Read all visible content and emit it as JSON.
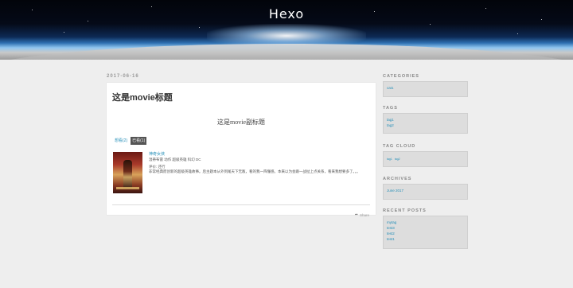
{
  "site": {
    "title": "Hexo"
  },
  "post": {
    "date": "2017-06-16",
    "title": "这是movie标题",
    "subtitle": "这是movie副标题",
    "tabs": [
      {
        "label": "想看(2)",
        "active": false
      },
      {
        "label": "已看(1)",
        "active": true
      }
    ],
    "movie": {
      "name": "神奇女侠",
      "meta": "温蒂布雷 动作 超级英雄 科幻 DC",
      "rating": "评价: 还行",
      "summary": "非常经典而创新的超级英雄故事。后主题本从外到尾天下无敌，看的我一阵懂感。本来以为会跟一战扯上点关系，看来我想要多了。。。"
    },
    "share_label": "Share"
  },
  "sidebar": {
    "categories": {
      "title": "CATEGORIES",
      "items": [
        "cat1"
      ]
    },
    "tags": {
      "title": "TAGS",
      "items": [
        "tag1",
        "tag2"
      ]
    },
    "tag_cloud": {
      "title": "TAG CLOUD",
      "items": [
        "tag1",
        "tag2"
      ]
    },
    "archives": {
      "title": "ARCHIVES",
      "items": [
        "June 2017"
      ]
    },
    "recent_posts": {
      "title": "RECENT POSTS",
      "items": [
        "mytag",
        "test3",
        "test2",
        "test1"
      ]
    }
  },
  "colors": {
    "link": "#258fb8",
    "background": "#eeeeee",
    "card": "#ffffff",
    "active_tab": "#555555"
  }
}
